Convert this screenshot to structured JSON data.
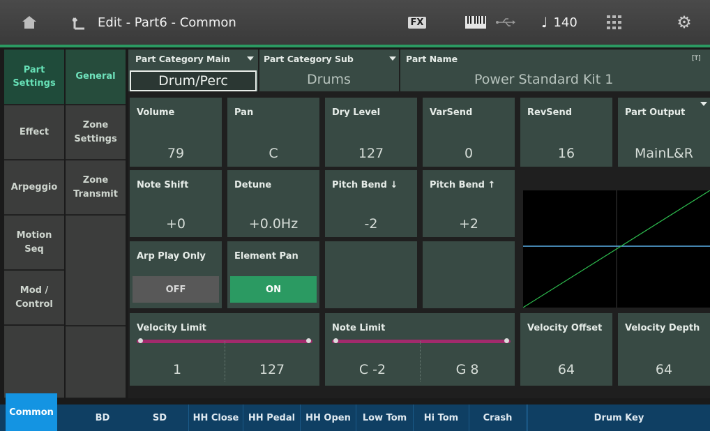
{
  "header": {
    "title": "Edit - Part6 - Common",
    "fx_label": "FX",
    "tempo_symbol": "♩",
    "tempo_value": "140",
    "icons": [
      "home-icon",
      "back-arrow-icon",
      "fx-badge",
      "keyboard-icon",
      "usb-icon",
      "grid-icon",
      "gear-icon"
    ]
  },
  "main_tabs": [
    {
      "label": "Part\nSettings",
      "active": true
    },
    {
      "label": "Effect",
      "active": false
    },
    {
      "label": "Arpeggio",
      "active": false
    },
    {
      "label": "Motion\nSeq",
      "active": false
    },
    {
      "label": "Mod /\nControl",
      "active": false
    }
  ],
  "sub_tabs": [
    {
      "label": "General",
      "active": true
    },
    {
      "label": "Zone\nSettings",
      "active": false
    },
    {
      "label": "Zone\nTransmit",
      "active": false
    }
  ],
  "category": {
    "main_label": "Part Category Main",
    "main_value": "Drum/Perc",
    "sub_label": "Part Category Sub",
    "sub_value": "Drums",
    "name_label": "Part Name",
    "name_value": "Power Standard Kit 1",
    "name_badge": "[T]"
  },
  "params_row1": [
    {
      "label": "Volume",
      "value": "79"
    },
    {
      "label": "Pan",
      "value": "C"
    },
    {
      "label": "Dry Level",
      "value": "127"
    },
    {
      "label": "VarSend",
      "value": "0"
    },
    {
      "label": "RevSend",
      "value": "16"
    },
    {
      "label": "Part Output",
      "value": "MainL&R"
    }
  ],
  "params_row2": [
    {
      "label": "Note Shift",
      "value": "+0"
    },
    {
      "label": "Detune",
      "value": "+0.0Hz"
    },
    {
      "label": "Pitch Bend ↓",
      "value": "-2"
    },
    {
      "label": "Pitch Bend ↑",
      "value": "+2"
    }
  ],
  "toggles": [
    {
      "label": "Arp Play Only",
      "state": "OFF"
    },
    {
      "label": "Element Pan",
      "state": "ON"
    }
  ],
  "velocity_limit": {
    "label": "Velocity Limit",
    "low": "1",
    "high": "127"
  },
  "note_limit": {
    "label": "Note Limit",
    "low": "C -2",
    "high": "G 8"
  },
  "velocity_offset": {
    "label": "Velocity Offset",
    "value": "64"
  },
  "velocity_depth": {
    "label": "Velocity Depth",
    "value": "64"
  },
  "bottom_tabs": [
    {
      "label": "Common",
      "active": true
    },
    {
      "label": "BD"
    },
    {
      "label": "SD"
    },
    {
      "label": "HH Close"
    },
    {
      "label": "HH Pedal"
    },
    {
      "label": "HH Open"
    },
    {
      "label": "Low Tom"
    },
    {
      "label": "Hi Tom"
    },
    {
      "label": "Crash"
    },
    {
      "label": "Drum Key"
    }
  ],
  "colors": {
    "accent_green": "#2b9a62",
    "active_tab_text": "#66e0b6",
    "panel_bg": "#384a44",
    "slider": "#a22a6c",
    "bottom_bar": "#0f3f63",
    "bottom_active": "#1494e2",
    "graph_line_green": "#2dbb4e",
    "graph_line_blue": "#5ab0e8"
  }
}
